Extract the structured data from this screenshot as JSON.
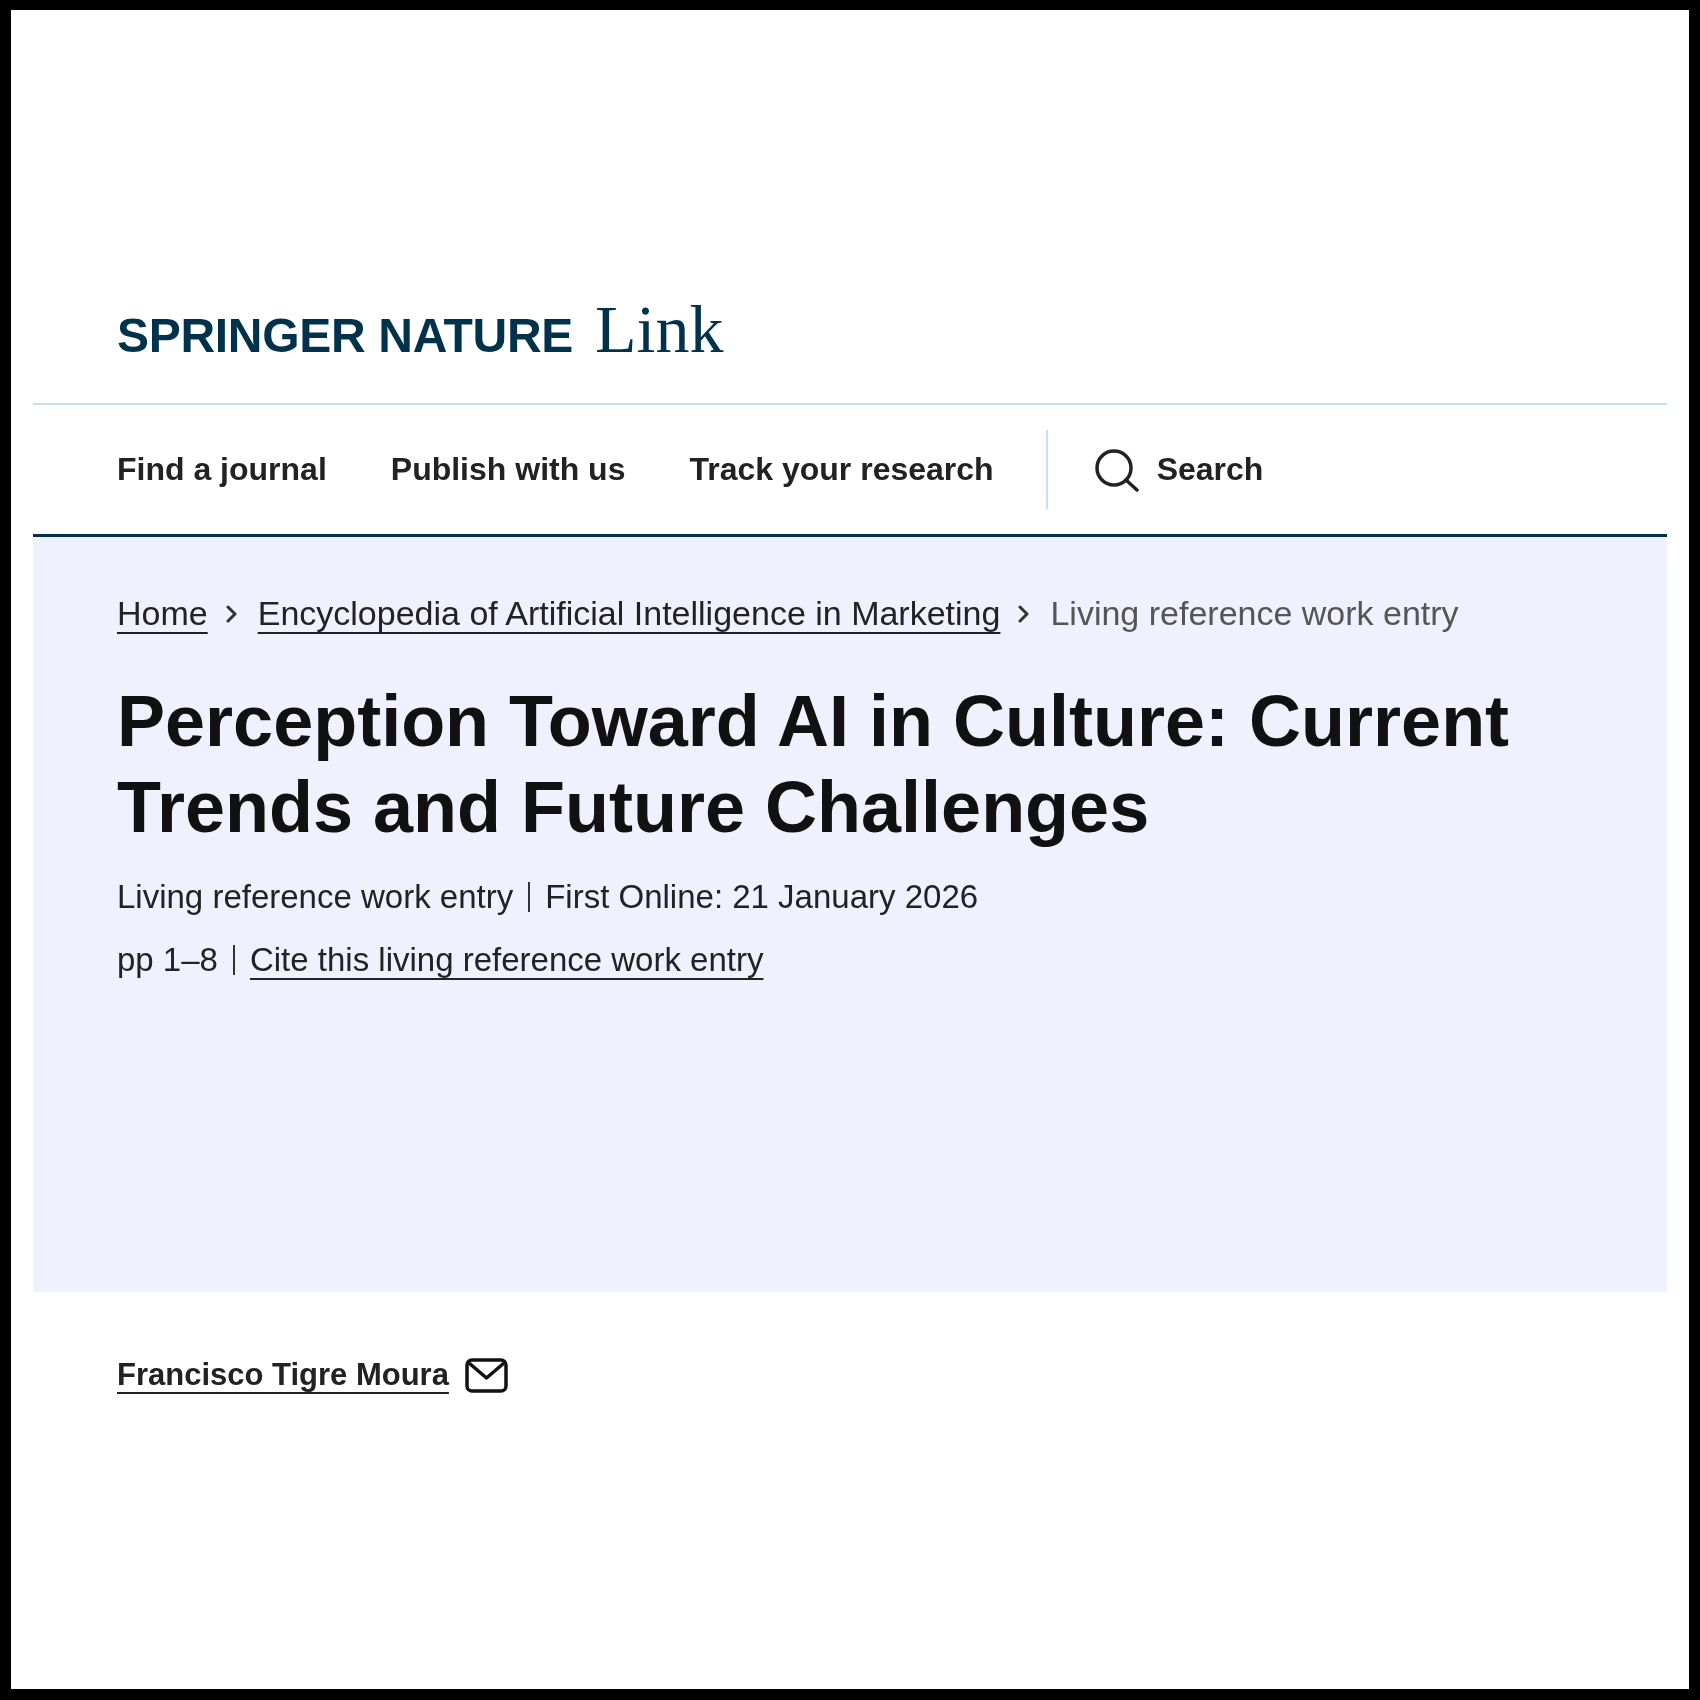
{
  "header": {
    "logo": {
      "brand": "SPRINGER NATURE",
      "product": "Link"
    },
    "nav": [
      {
        "label": "Find a journal"
      },
      {
        "label": "Publish with us"
      },
      {
        "label": "Track your research"
      }
    ],
    "search": {
      "label": "Search"
    }
  },
  "breadcrumb": [
    {
      "label": "Home",
      "kind": "link"
    },
    {
      "label": "Encyclopedia of Artificial Intelligence in Marketing",
      "kind": "link"
    },
    {
      "label": "Living reference work entry",
      "kind": "current"
    }
  ],
  "article": {
    "title": "Perception Toward AI in Culture: Current Trends and Future Challenges",
    "content_type": "Living reference work entry",
    "first_online": "First Online: 21 January 2026",
    "pages": "pp 1–8",
    "cite_link": "Cite this living reference work entry"
  },
  "authors": [
    {
      "name": "Francisco Tigre Moura"
    }
  ]
}
